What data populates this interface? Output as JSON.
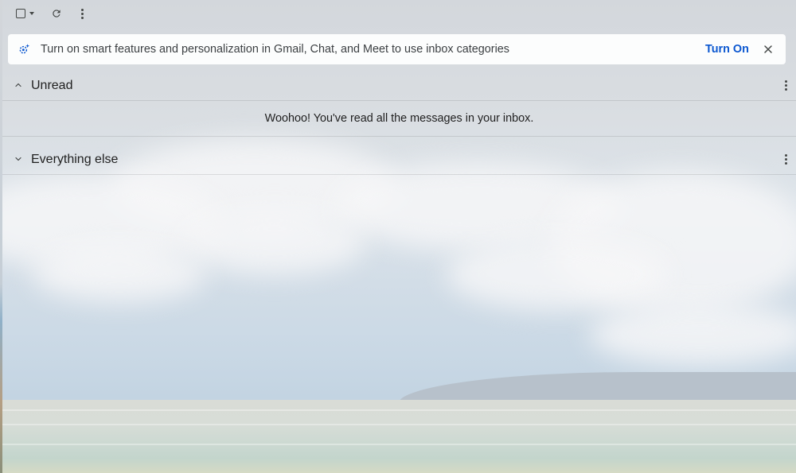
{
  "toolbar": {
    "select_icon": "checkbox-icon",
    "select_menu_icon": "caret-down-icon",
    "refresh_icon": "refresh-icon",
    "more_icon": "more-vert-icon"
  },
  "banner": {
    "icon": "smart-features-sparkle-icon",
    "text": "Turn on smart features and personalization in Gmail, Chat, and Meet to use inbox categories",
    "action_label": "Turn On",
    "close_icon": "close-icon"
  },
  "sections": {
    "unread": {
      "title": "Unread",
      "expanded": true,
      "empty_message": "Woohoo! You've read all the messages in your inbox."
    },
    "everything_else": {
      "title": "Everything else",
      "expanded": false
    }
  },
  "colors": {
    "accent": "#0b57d0",
    "icon": "#444746",
    "text": "#1f1f1f",
    "banner_icon": "#0b57d0"
  }
}
